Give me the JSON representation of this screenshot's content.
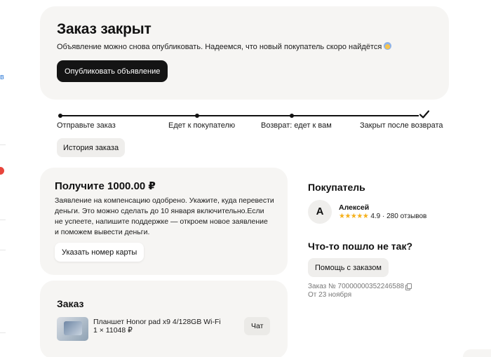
{
  "sidebar": {
    "cut_text": "в"
  },
  "banner": {
    "title": "Заказ закрыт",
    "subtitle": "Объявление можно снова опубликовать. Надеемся, что новый покупатель скоро найдётся",
    "publish_button": "Опубликовать объявление"
  },
  "progress": {
    "steps": [
      {
        "label": "Отправьте заказ"
      },
      {
        "label": "Едет к покупателю"
      },
      {
        "label": "Возврат: едет к вам"
      },
      {
        "label": "Закрыт после возврата"
      }
    ],
    "history_button": "История заказа"
  },
  "compensation": {
    "title": "Получите 1000.00 ₽",
    "lines": [
      "Заявление на компенсацию одобрено. Укажите, куда перевести",
      "деньги. Это можно сделать до 10 января включительно.Если",
      "не успеете, напишите поддержке — откроем новое заявление",
      "и поможем вывести деньги."
    ],
    "card_button": "Указать номер карты"
  },
  "order": {
    "title": "Заказ",
    "item_name": "Планшет Honor pad x9 4/128GB Wi-Fi",
    "item_qty": "1 × 11048 ₽",
    "chat_button": "Чат"
  },
  "buyer": {
    "title": "Покупатель",
    "initial": "А",
    "name": "Алексей",
    "stars": "★★★★★",
    "rating_text": "4.9 · 280 отзывов"
  },
  "help": {
    "title": "Что-то пошло не так?",
    "button": "Помощь с заказом",
    "order_number": "Заказ № 70000000352246588",
    "order_date": "От 23 ноября"
  },
  "colors": {
    "card_bg": "#f6f5f3",
    "primary_button": "#141414",
    "star": "#f5b01a",
    "muted_text": "#777777"
  }
}
